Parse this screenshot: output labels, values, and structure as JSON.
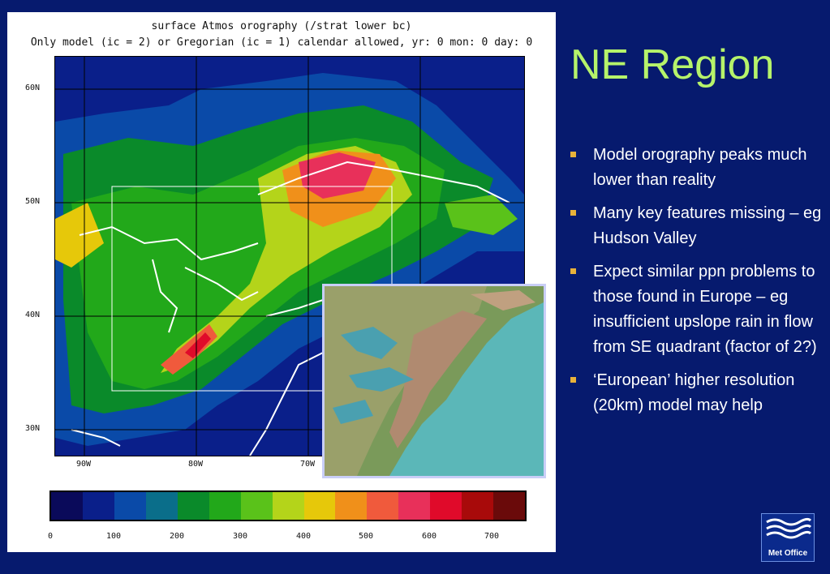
{
  "slide": {
    "title": "NE Region",
    "bullets": [
      "Model orography peaks much lower than reality",
      "Many key features missing – eg Hudson Valley",
      "Expect similar ppn problems to those found in Europe – eg insufficient upslope rain in flow from SE quadrant (factor of 2?)",
      "‘European’ higher resolution (20km) model may help"
    ],
    "bullet_color": "#e8b23a",
    "title_color": "#b6f36a",
    "background_color": "#061a6e"
  },
  "figure": {
    "title_line1": "surface Atmos orography (/strat lower bc)",
    "title_line2": "Only model (ic = 2) or Gregorian (ic = 1) calendar allowed, yr: 0 mon: 0 day: 0",
    "x_ticks": [
      "90W",
      "80W",
      "70W"
    ],
    "y_ticks": [
      "60N",
      "50N",
      "40N",
      "30N"
    ],
    "colorbar_labels": [
      "0",
      "100",
      "200",
      "300",
      "400",
      "500",
      "600",
      "700"
    ],
    "colorbar_colors": [
      "#0a0a5a",
      "#0a1f8a",
      "#0a4aa8",
      "#0a6e8a",
      "#0a8a2a",
      "#22a81a",
      "#5ac21a",
      "#b4d41a",
      "#e6c80a",
      "#f0901a",
      "#f05a3c",
      "#e8305a",
      "#e00a2a",
      "#a80a0a",
      "#6a0a0a"
    ]
  },
  "inset": {
    "icon": "terrain-relief-map"
  },
  "logo": {
    "label": "Met Office",
    "icon": "wave-lines-icon"
  }
}
